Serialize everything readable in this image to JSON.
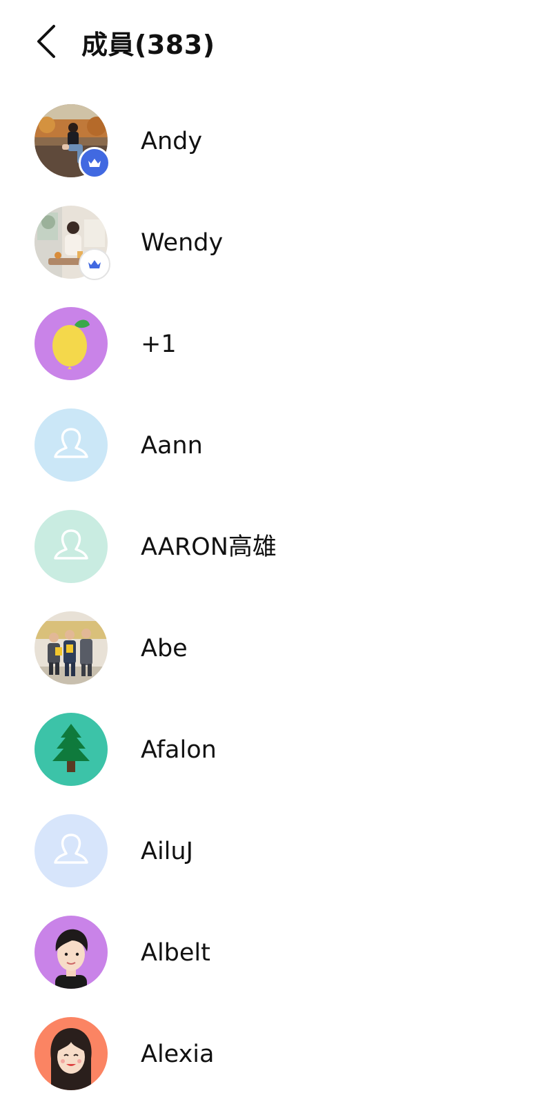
{
  "header": {
    "title": "成員(383)",
    "back_icon": "chevron-left-icon"
  },
  "members": [
    {
      "name": "Andy",
      "avatar": "photo-woman-sitting-outdoors",
      "badge": "crown-icon",
      "badge_style": "filled",
      "badge_color": "#4169e1"
    },
    {
      "name": "Wendy",
      "avatar": "photo-woman-cafe",
      "badge": "crown-icon",
      "badge_style": "outline",
      "badge_color": "#4169e1"
    },
    {
      "name": "+1",
      "avatar": "lemon-icon",
      "bg": "#c983e8"
    },
    {
      "name": "Aann",
      "avatar": "default-person-icon",
      "bg": "#cbe7f7"
    },
    {
      "name": "AARON高雄",
      "avatar": "default-person-icon",
      "bg": "#c9ece1"
    },
    {
      "name": "Abe",
      "avatar": "photo-three-men-suits"
    },
    {
      "name": "Afalon",
      "avatar": "pine-tree-icon",
      "bg": "#3cc3a8"
    },
    {
      "name": "AiluJ",
      "avatar": "default-person-icon",
      "bg": "#d7e5fb"
    },
    {
      "name": "Albelt",
      "avatar": "cartoon-man-icon",
      "bg": "#c983e8"
    },
    {
      "name": "Alexia",
      "avatar": "cartoon-woman-icon",
      "bg": "#fb8463"
    }
  ]
}
